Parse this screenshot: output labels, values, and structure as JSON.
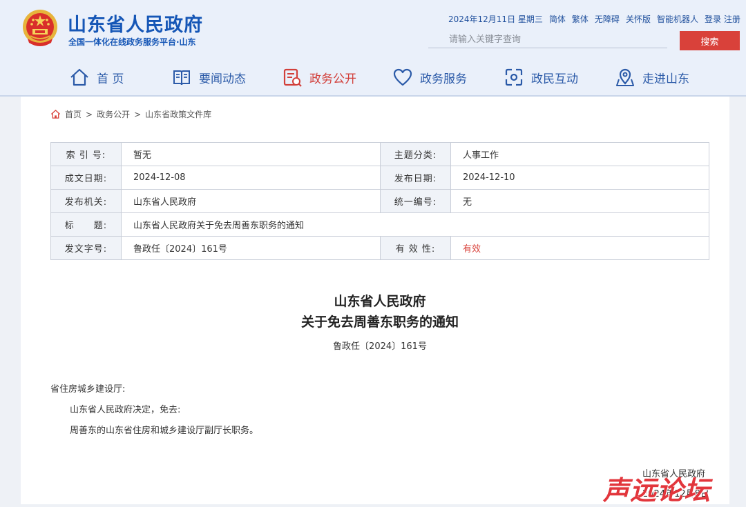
{
  "site": {
    "title": "山东省人民政府",
    "subtitle": "全国一体化在线政务服务平台·山东"
  },
  "top_links": {
    "date": "2024年12月11日 星期三",
    "simplified": "简体",
    "traditional": "繁体",
    "accessible": "无障碍",
    "elder": "关怀版",
    "robot": "智能机器人",
    "login": "登录",
    "register": "注册"
  },
  "search": {
    "placeholder": "请输入关键字查询",
    "button_label": "搜索"
  },
  "nav": {
    "home": "首 页",
    "news": "要闻动态",
    "open": "政务公开",
    "service": "政务服务",
    "interact": "政民互动",
    "about": "走进山东"
  },
  "breadcrumb": {
    "home": "首页",
    "sep": ">",
    "section": "政务公开",
    "page": "山东省政策文件库"
  },
  "meta": {
    "index_label": "索 引 号:",
    "index_value": "暂无",
    "topic_label": "主题分类:",
    "topic_value": "人事工作",
    "created_label": "成文日期:",
    "created_value": "2024-12-08",
    "published_label": "发布日期:",
    "published_value": "2024-12-10",
    "issuer_label": "发布机关:",
    "issuer_value": "山东省人民政府",
    "uniform_label": "统一编号:",
    "uniform_value": "无",
    "title_label": "标　　题:",
    "title_value": "山东省人民政府关于免去周善东职务的通知",
    "docno_label": "发文字号:",
    "docno_value": "鲁政任〔2024〕161号",
    "validity_label": "有 效 性:",
    "validity_value": "有效"
  },
  "document": {
    "title_line1": "山东省人民政府",
    "title_line2": "关于免去周善东职务的通知",
    "number": "鲁政任〔2024〕161号",
    "addressee": "省住房城乡建设厅:",
    "para1": "山东省人民政府决定，免去:",
    "para2": "周善东的山东省住房和城乡建设厅副厅长职务。",
    "signer": "山东省人民政府",
    "date": "2024年12月8日"
  },
  "watermark": "声远论坛",
  "colors": {
    "brand_blue": "#1556b6",
    "accent_red": "#d9413a"
  }
}
